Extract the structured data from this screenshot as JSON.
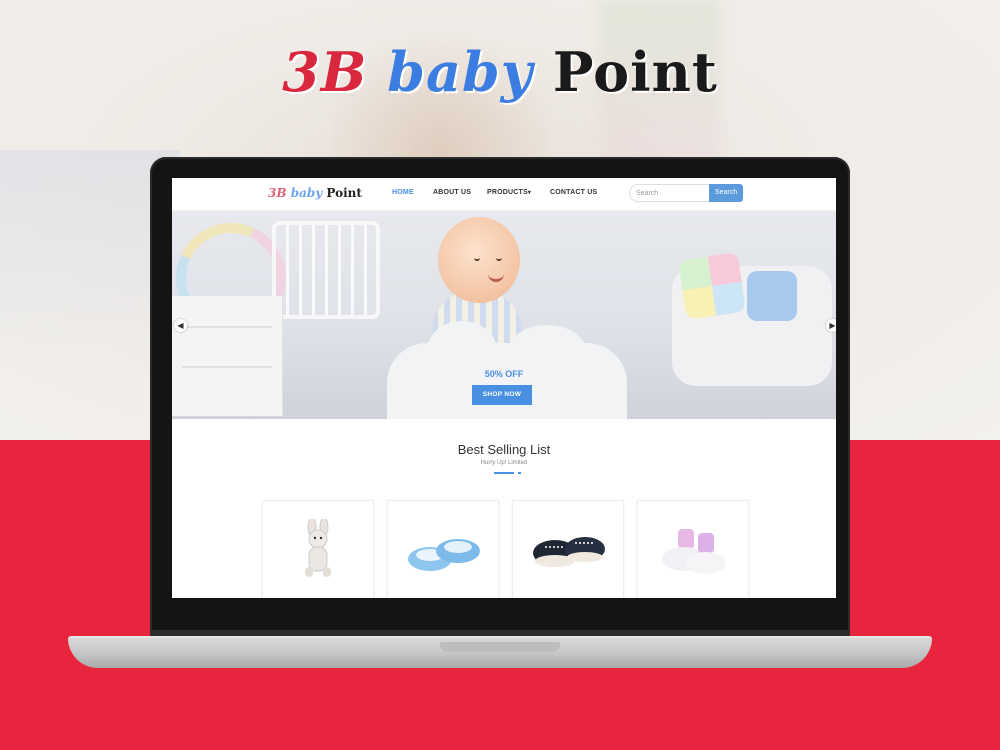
{
  "brand": {
    "part1": "3B",
    "part2": "baby",
    "part3": "Point"
  },
  "site": {
    "logo": {
      "part1": "3B",
      "part2": "baby",
      "part3": "Point"
    },
    "nav": [
      {
        "label": "HOME",
        "active": true
      },
      {
        "label": "ABOUT US",
        "active": false
      },
      {
        "label": "PRODUCTS",
        "active": false,
        "has_dropdown": true
      },
      {
        "label": "CONTACT US",
        "active": false
      }
    ],
    "search": {
      "placeholder": "Search",
      "button": "Search"
    },
    "hero": {
      "promo": "50% OFF",
      "button": "SHOP NOW"
    },
    "best_selling": {
      "title": "Best Selling List",
      "subtitle": "Hurry Up! Limited",
      "products": [
        {
          "icon": "plush-bunny-icon"
        },
        {
          "icon": "blue-baby-shoes-icon"
        },
        {
          "icon": "black-baby-sneakers-icon"
        },
        {
          "icon": "pink-baby-booties-icon"
        }
      ]
    }
  },
  "colors": {
    "accent": "#4a90e2",
    "brand_red": "#e8253f"
  }
}
